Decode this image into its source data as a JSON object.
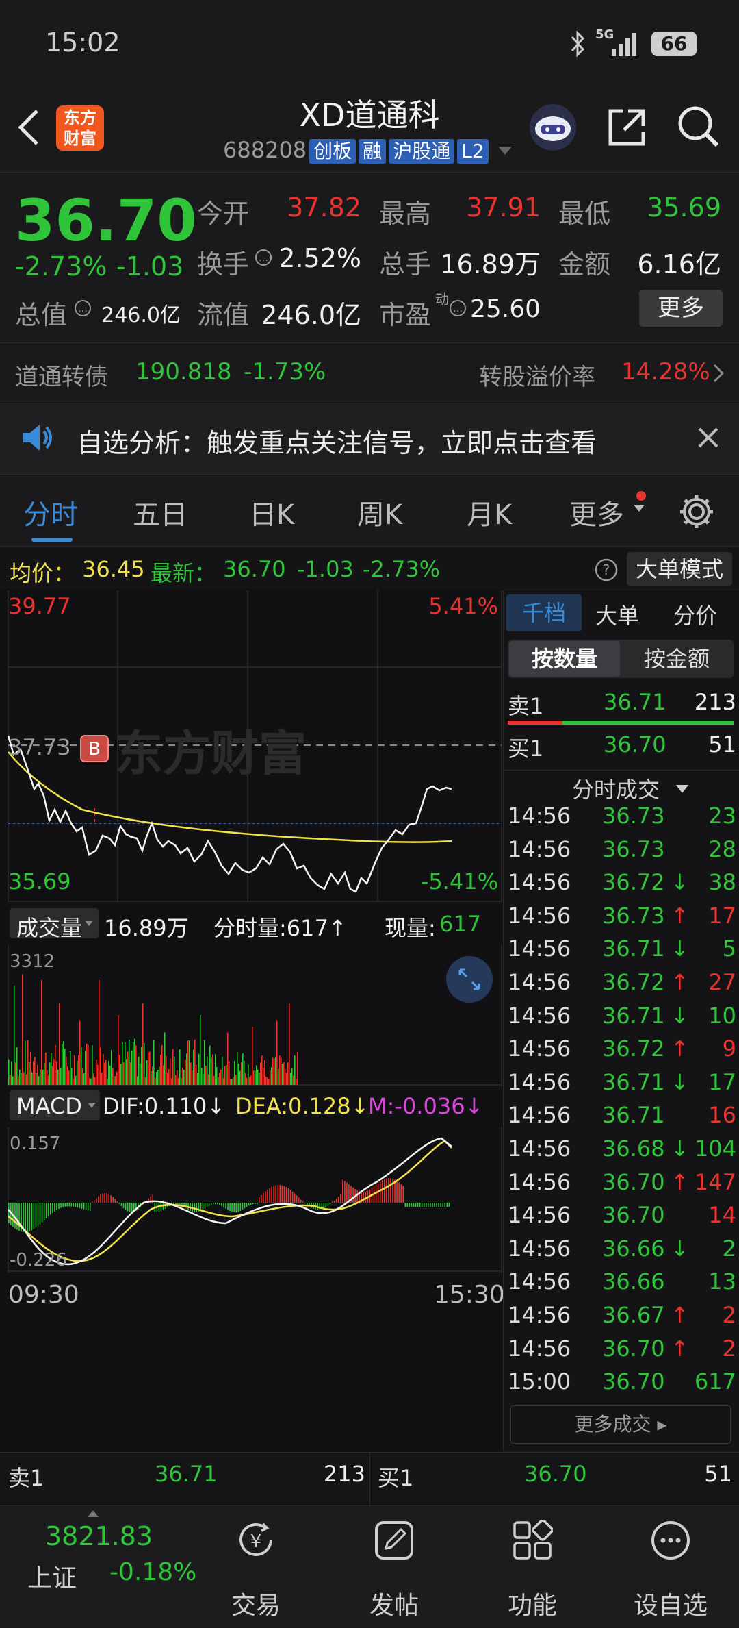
{
  "status": {
    "time": "15:02",
    "network": "5G",
    "battery": "66"
  },
  "header": {
    "title": "XD道通科",
    "code": "688208",
    "tags": [
      "创板",
      "融",
      "沪股通",
      "L2"
    ],
    "logo_line1": "东方",
    "logo_line2": "财富"
  },
  "quote": {
    "price": "36.70",
    "change_pct": "-2.73%",
    "change": "-1.03",
    "open_label": "今开",
    "open": "37.82",
    "high_label": "最高",
    "high": "37.91",
    "low_label": "最低",
    "low": "35.69",
    "turnover_label": "换手",
    "turnover": "2.52%",
    "volume_label": "总手",
    "volume": "16.89万",
    "amount_label": "金额",
    "amount": "6.16亿",
    "mktcap_label": "总值",
    "mktcap": "246.0亿",
    "float_label": "流值",
    "float": "246.0亿",
    "pe_label": "市盈",
    "pe_super": "动",
    "pe": "25.60",
    "more_button": "更多"
  },
  "convertible": {
    "name": "道通转债",
    "price": "190.818",
    "change": "-1.73%",
    "premium_label": "转股溢价率",
    "premium": "14.28%"
  },
  "notice": {
    "text": "自选分析：触发重点关注信号，立即点击查看"
  },
  "tabs": [
    "分时",
    "五日",
    "日K",
    "周K",
    "月K",
    "更多"
  ],
  "info_bar": {
    "avg_label": "均价：",
    "avg": "36.45",
    "latest_label": "最新：",
    "latest": "36.70",
    "change": "-1.03",
    "change_pct": "-2.73%",
    "mode_button": "大单模式"
  },
  "price_chart": {
    "ymax": "39.77",
    "ymax_pct": "5.41%",
    "ref": "37.73",
    "ymin": "35.69",
    "ymin_pct": "-5.41%",
    "marker": "B",
    "watermark": "东方财富"
  },
  "volume_bar": {
    "label": "成交量",
    "total": "16.89万",
    "tick_label": "分时量:617↑",
    "now_label": "现量:",
    "now": "617",
    "ymax": "3312"
  },
  "macd_bar": {
    "label": "MACD",
    "dif": "DIF:0.110↓",
    "dea": "DEA:0.128↓",
    "m": "M:-0.036↓",
    "ymax": "0.157",
    "ymin": "-0.226"
  },
  "time_axis": {
    "start": "09:30",
    "end": "15:30"
  },
  "side": {
    "tabs": [
      "千档",
      "大单",
      "分价"
    ],
    "subtabs": [
      "按数量",
      "按金额"
    ],
    "sell1": {
      "label": "卖1",
      "price": "36.71",
      "vol": "213"
    },
    "buy1": {
      "label": "买1",
      "price": "36.70",
      "vol": "51"
    },
    "ticks_title": "分时成交",
    "ticks": [
      {
        "t": "14:56",
        "p": "36.73",
        "a": "",
        "v": "23",
        "c": "green"
      },
      {
        "t": "14:56",
        "p": "36.73",
        "a": "",
        "v": "28",
        "c": "green"
      },
      {
        "t": "14:56",
        "p": "36.72",
        "a": "↓",
        "v": "38",
        "c": "green"
      },
      {
        "t": "14:56",
        "p": "36.73",
        "a": "↑",
        "v": "17",
        "c": "red"
      },
      {
        "t": "14:56",
        "p": "36.71",
        "a": "↓",
        "v": "5",
        "c": "green"
      },
      {
        "t": "14:56",
        "p": "36.72",
        "a": "↑",
        "v": "27",
        "c": "red"
      },
      {
        "t": "14:56",
        "p": "36.71",
        "a": "↓",
        "v": "10",
        "c": "green"
      },
      {
        "t": "14:56",
        "p": "36.72",
        "a": "↑",
        "v": "9",
        "c": "red"
      },
      {
        "t": "14:56",
        "p": "36.71",
        "a": "↓",
        "v": "17",
        "c": "green"
      },
      {
        "t": "14:56",
        "p": "36.71",
        "a": "",
        "v": "16",
        "c": "red"
      },
      {
        "t": "14:56",
        "p": "36.68",
        "a": "↓",
        "v": "104",
        "c": "green"
      },
      {
        "t": "14:56",
        "p": "36.70",
        "a": "↑",
        "v": "147",
        "c": "red"
      },
      {
        "t": "14:56",
        "p": "36.70",
        "a": "",
        "v": "14",
        "c": "red"
      },
      {
        "t": "14:56",
        "p": "36.66",
        "a": "↓",
        "v": "2",
        "c": "green"
      },
      {
        "t": "14:56",
        "p": "36.66",
        "a": "",
        "v": "13",
        "c": "green"
      },
      {
        "t": "14:56",
        "p": "36.67",
        "a": "↑",
        "v": "2",
        "c": "red"
      },
      {
        "t": "14:56",
        "p": "36.70",
        "a": "↑",
        "v": "2",
        "c": "red"
      },
      {
        "t": "15:00",
        "p": "36.70",
        "a": "",
        "v": "617",
        "c": "green"
      }
    ],
    "more_ticks": "更多成交"
  },
  "bottom_orderbook": {
    "sell_label": "卖1",
    "sell_price": "36.71",
    "sell_vol": "213",
    "buy_label": "买1",
    "buy_price": "36.70",
    "buy_vol": "51"
  },
  "nav": {
    "index_value": "3821.83",
    "index_name": "上证",
    "index_change": "-0.18%",
    "items": [
      "交易",
      "发帖",
      "功能",
      "设自选"
    ]
  },
  "colors": {
    "up": "#e8332f",
    "down": "#2fc43a",
    "avg_line": "#f2e24a",
    "accent": "#3a8bd8"
  }
}
